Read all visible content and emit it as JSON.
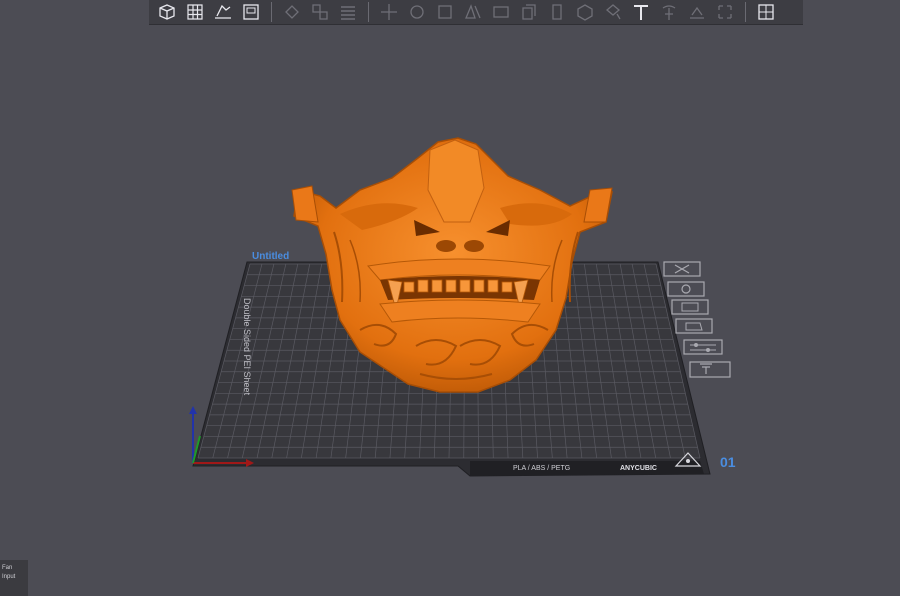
{
  "toolbar": {
    "groups": [
      {
        "icons": [
          "add-model-icon",
          "grid-icon",
          "auto-arrange-icon",
          "plate-icon"
        ],
        "active": true
      },
      {
        "icons": [
          "hollow-icon",
          "multi-copy-icon",
          "layers-icon"
        ],
        "active": false
      },
      {
        "icons": [
          "move-icon",
          "rotate-icon",
          "scale-icon",
          "mirror-icon",
          "cut-icon",
          "duplicate-icon",
          "drop-icon",
          "primitive-icon",
          "paint-icon",
          "text-icon",
          "support-icon",
          "flatten-icon",
          "measure-icon"
        ],
        "active": false
      },
      {
        "icons": [
          "puzzle-icon"
        ],
        "active": true
      }
    ]
  },
  "plate": {
    "name": "Untitled",
    "side_label": "Double Sided PEI Sheet",
    "material_label": "PLA / ABS / PETG",
    "brand_label": "ANYCUBIC",
    "plate_number": "01",
    "accent": "#4a8de0",
    "model_color": "#f07d1a",
    "side_icons": [
      "delete-plate-icon",
      "plate-settings-icon",
      "arrange-plate-icon",
      "orient-plate-icon",
      "plate-options-icon",
      "lock-plate-icon"
    ]
  },
  "corner_panel": {
    "line1": "Fan",
    "line2": "Input"
  }
}
